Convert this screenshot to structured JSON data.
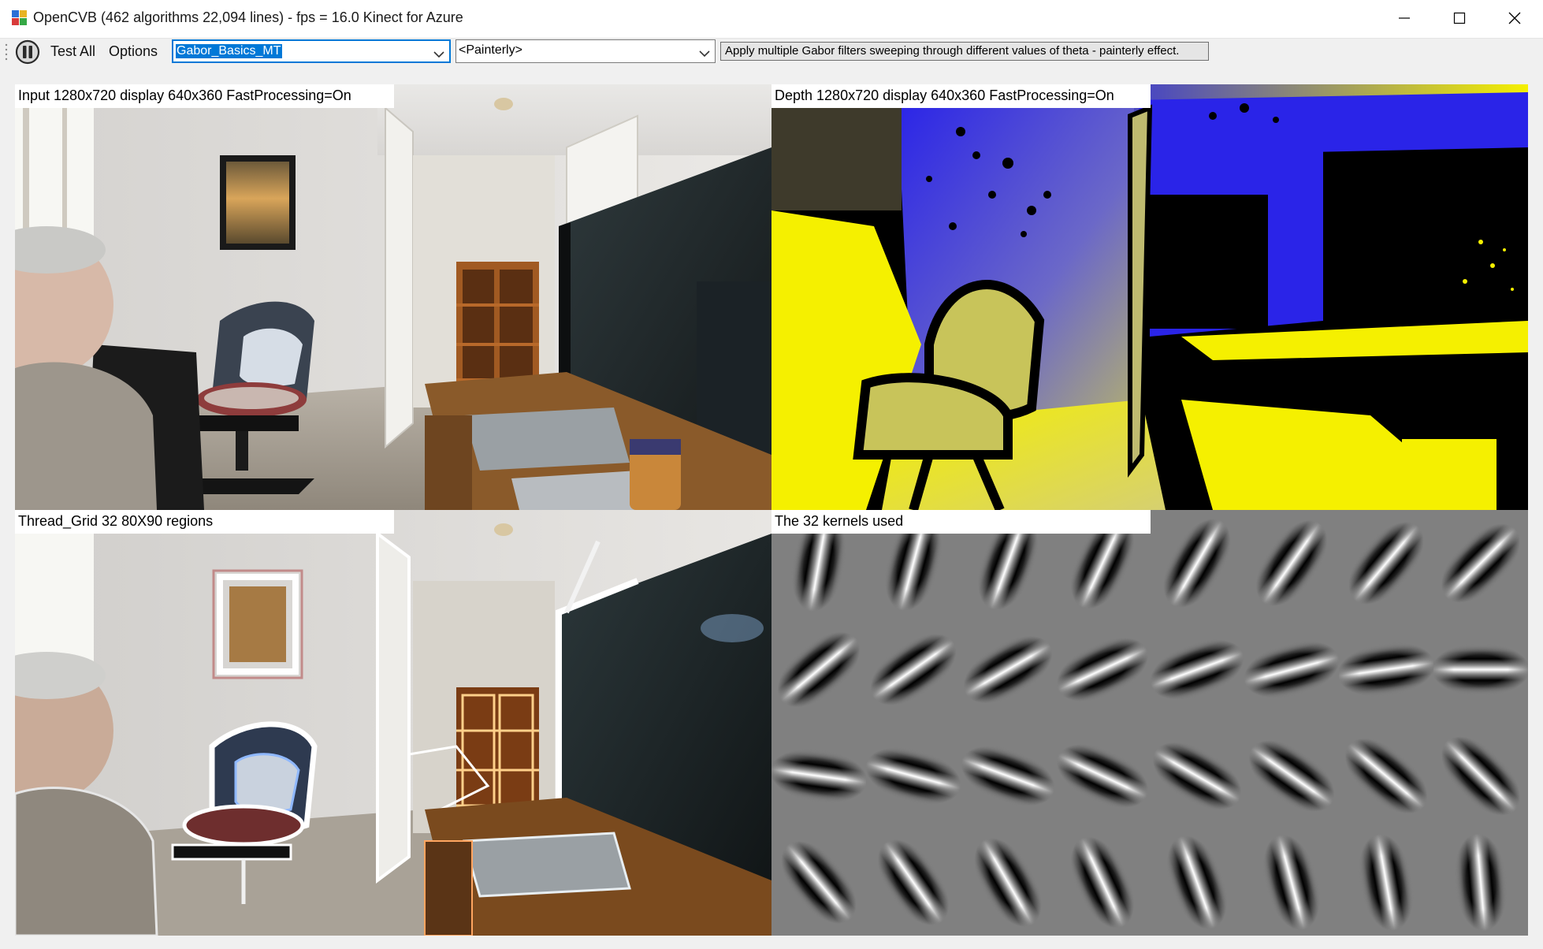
{
  "window": {
    "title": "OpenCVB (462 algorithms 22,094 lines) - fps = 16.0 Kinect for Azure",
    "app_icon": "opencvb-app-icon",
    "controls": [
      "minimize-icon",
      "maximize-icon",
      "close-icon"
    ]
  },
  "toolbar": {
    "pause_icon": "pause-icon",
    "test_all_label": "Test All",
    "options_label": "Options",
    "algorithm_selected": "Gabor_Basics_MT",
    "group_selected": "<Painterly>",
    "description": "Apply multiple Gabor filters sweeping through different values of theta - painterly effect."
  },
  "panels": [
    {
      "label": "Input  1280x720  display  640x360  FastProcessing=On",
      "content": "camera color image of a home office"
    },
    {
      "label": "Depth  1280x720  display  640x360  FastProcessing=On",
      "content": "depth image in yellow, blue and black"
    },
    {
      "label": "Thread_Grid 32 80X90 regions",
      "content": "painterly Gabor-filtered color image"
    },
    {
      "label": "The 32 kernels used",
      "content": "grid of 32 Gabor kernels"
    }
  ],
  "kernels": {
    "count": 32,
    "columns": 8,
    "rows": 4,
    "theta_degrees": [
      10,
      15,
      20,
      25,
      30,
      35,
      40,
      45,
      50,
      55,
      60,
      65,
      70,
      75,
      82,
      90,
      98,
      105,
      110,
      115,
      120,
      125,
      130,
      135,
      140,
      145,
      150,
      155,
      160,
      165,
      170,
      175
    ]
  },
  "colors": {
    "accent": "#0078d7",
    "depth_near": "#f5f000",
    "depth_mid": "#2a24e8",
    "depth_far": "#000000",
    "kernel_background": "#808080"
  }
}
